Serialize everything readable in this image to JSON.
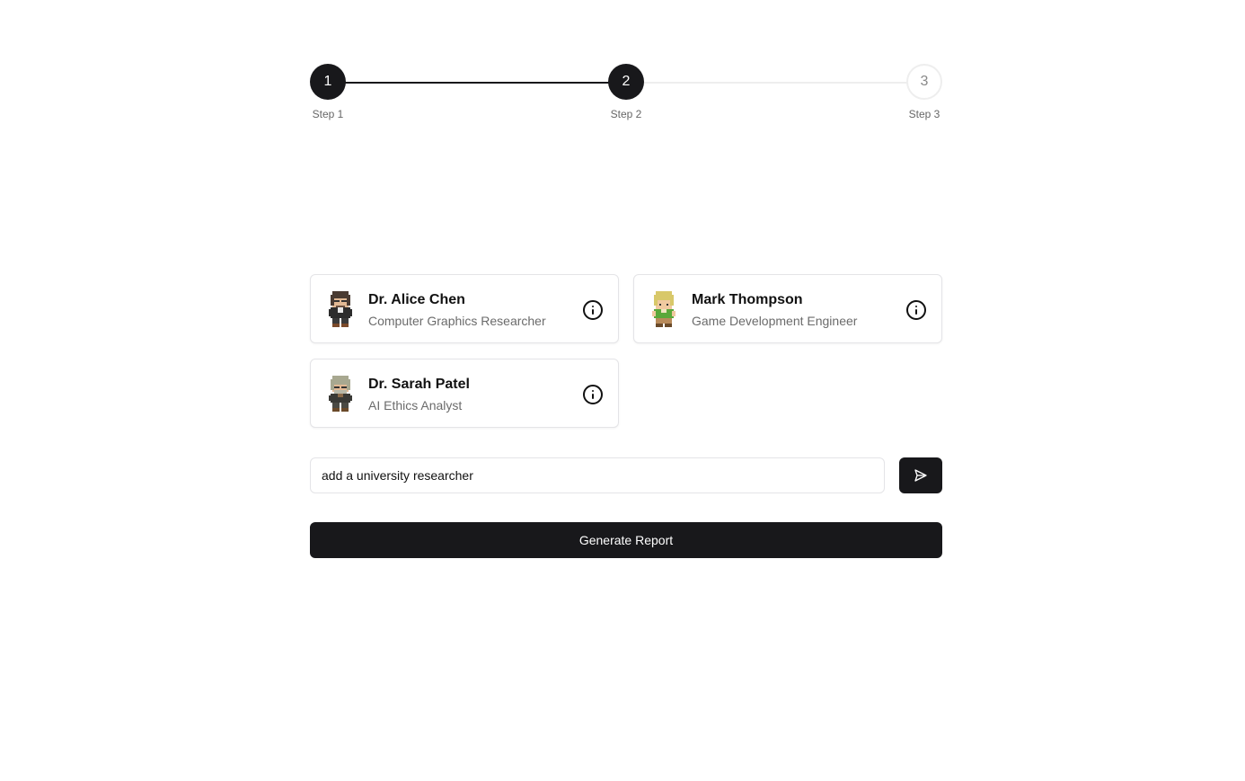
{
  "stepper": {
    "steps": [
      {
        "number": "1",
        "label": "Step 1",
        "state": "complete"
      },
      {
        "number": "2",
        "label": "Step 2",
        "state": "current"
      },
      {
        "number": "3",
        "label": "Step 3",
        "state": "upcoming"
      }
    ]
  },
  "personas": [
    {
      "name": "Dr. Alice Chen",
      "role": "Computer Graphics Researcher",
      "avatar_icon": "pixel-character-dark-hair-icon"
    },
    {
      "name": "Mark Thompson",
      "role": "Game Development Engineer",
      "avatar_icon": "pixel-character-blonde-green-icon"
    },
    {
      "name": "Dr. Sarah Patel",
      "role": "AI Ethics Analyst",
      "avatar_icon": "pixel-character-gray-hair-icon"
    }
  ],
  "prompt": {
    "value": "add a university researcher"
  },
  "actions": {
    "generate_label": "Generate Report"
  },
  "colors": {
    "primary": "#18181b",
    "border": "#e4e4e7",
    "muted_text": "#6b6b6b"
  }
}
